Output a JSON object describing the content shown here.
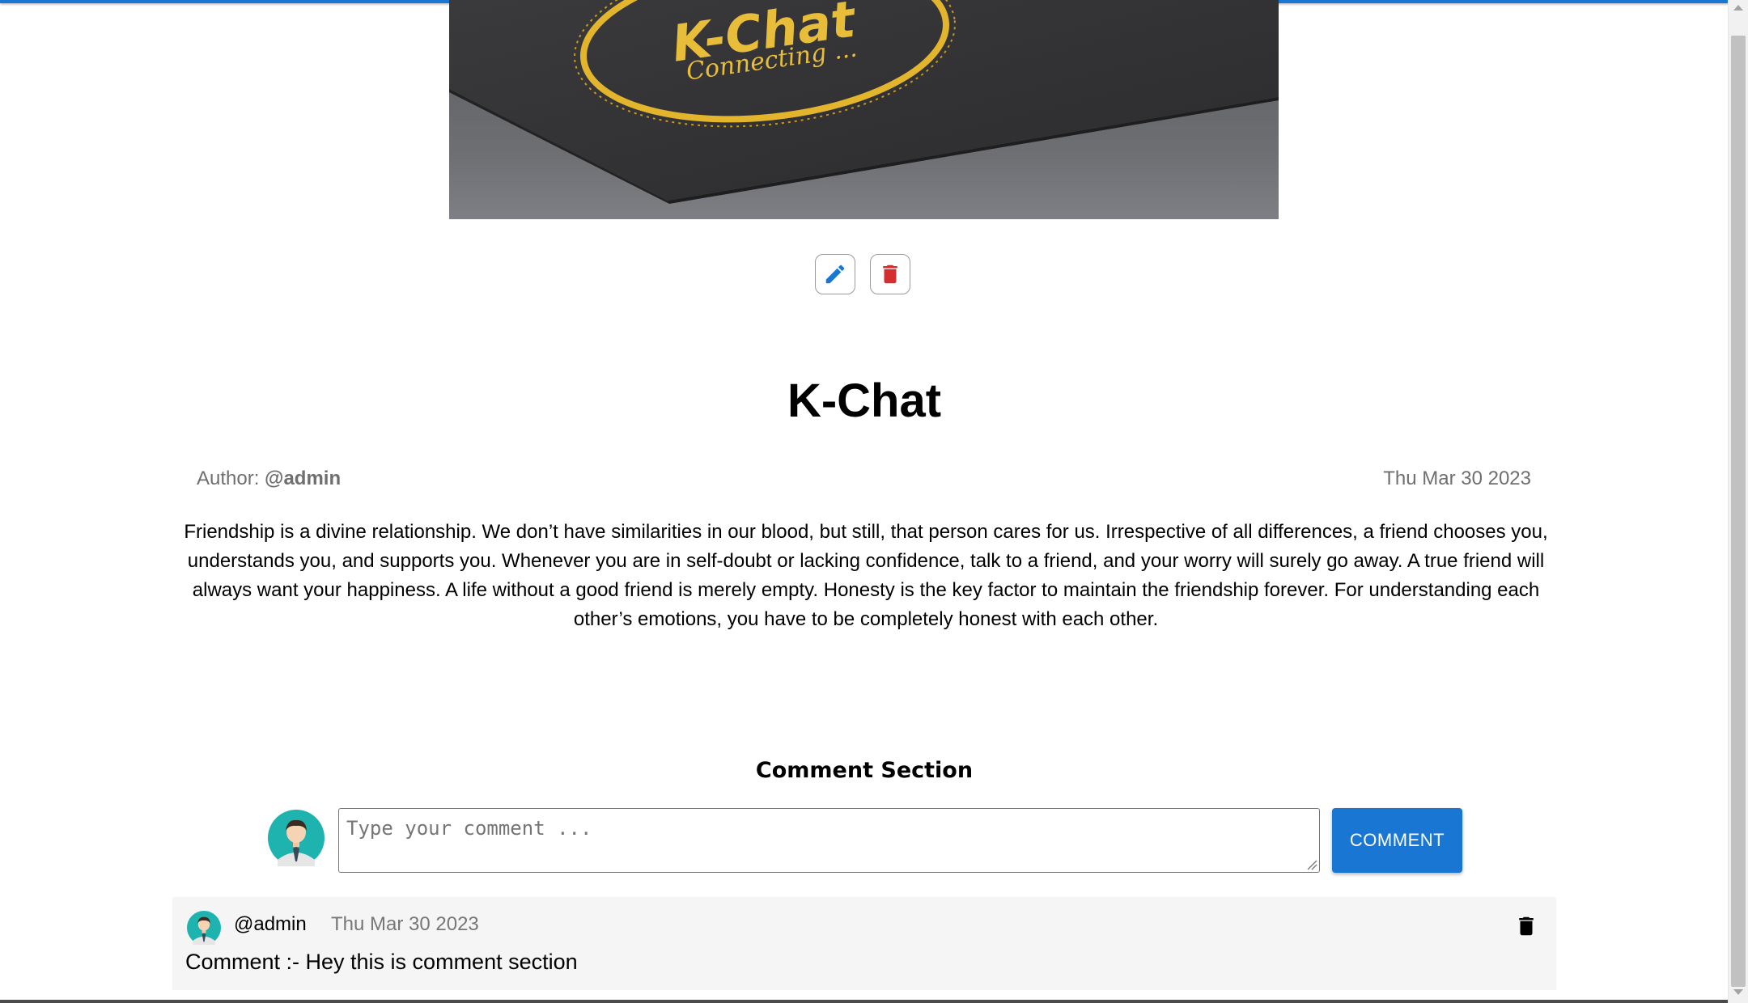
{
  "banner": {
    "logo_text": "K-Chat",
    "logo_subtext": "Connecting ..."
  },
  "actions": {
    "edit_icon": "pencil-icon",
    "delete_icon": "trash-icon"
  },
  "post": {
    "title": "K-Chat",
    "author_label": "Author: ",
    "author_name": "@admin",
    "date": "Thu Mar 30 2023",
    "body": "Friendship is a divine relationship. We don’t have similarities in our blood, but still, that person cares for us. Irrespective of all differences, a friend chooses you, understands you, and supports you. Whenever you are in self-doubt or lacking confidence, talk to a friend, and your worry will surely go away. A true friend will always want your happiness. A life without a good friend is merely empty. Honesty is the key factor to maintain the friendship forever. For understanding each other’s emotions, you have to be completely honest with each other."
  },
  "comments": {
    "heading": "Comment Section",
    "input_placeholder": "Type your comment ...",
    "submit_label": "COMMENT",
    "items": [
      {
        "user": "@admin",
        "date": "Thu Mar 30 2023",
        "text": "Comment :- Hey this is comment section"
      }
    ]
  },
  "colors": {
    "primary": "#1976d2",
    "delete": "#d32f2f",
    "logo_gold": "#e2b52c"
  }
}
